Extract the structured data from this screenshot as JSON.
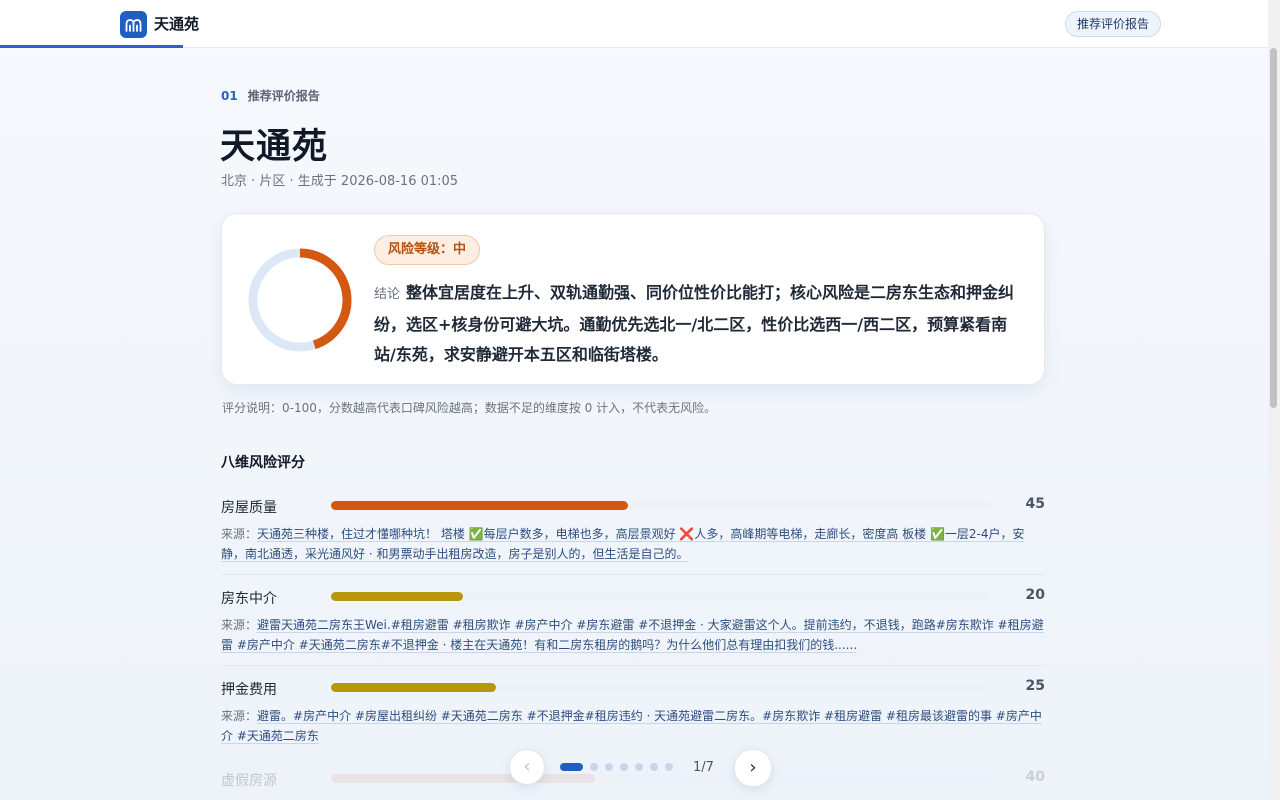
{
  "header": {
    "brand": "天通苑",
    "button_label": "推荐评价报告"
  },
  "hero": {
    "section_number": "01",
    "section_label": "推荐评价报告",
    "title": "天通苑",
    "meta": "北京 · 片区 · 生成于 2026-08-16 01:05"
  },
  "summary": {
    "risk_badge": "风险等级：中",
    "conclusion_label": "结论",
    "conclusion_text": "整体宜居度在上升、双轨通勤强、同价位性价比能打；核心风险是二房东生态和押金纠纷，选区+核身份可避大坑。通勤优先选北一/北二区，性价比选西一/西二区，预算紧看南站/东苑，求安静避开本五区和临街塔楼。",
    "ring_fraction": 0.45,
    "ring_color": "#d4580f"
  },
  "note": "评分说明：0-100，分数越高代表口碑风险越高；数据不足的维度按 0 计入，不代表无风险。",
  "dimensions_title": "八维风险评分",
  "source_label": "来源：",
  "dimensions": [
    {
      "name": "房屋质量",
      "score": "45",
      "value": 45,
      "color": "#d4580f",
      "source": "天通苑三种楼，住过才懂哪种坑！ 塔楼 ✅每层户数多，电梯也多，高层景观好 ❌人多，高峰期等电梯，走廊长，密度高 板楼 ✅一层2-4户，安静，南北通透，采光通风好 · 和男票动手出租房改造，房子是别人的，但生活是自己的。"
    },
    {
      "name": "房东中介",
      "score": "20",
      "value": 20,
      "color": "#b8960e",
      "source": "避雷天通苑二房东王Wei.#租房避雷 #租房欺诈 #房产中介 #房东避雷 #不退押金 · 大家避雷这个人。提前违约，不退钱，跑路#房东欺诈 #租房避雷 #房产中介 #天通苑二房东#不退押金 · 楼主在天通苑！有和二房东租房的鹅吗？为什么他们总有理由扣我们的钱......"
    },
    {
      "name": "押金费用",
      "score": "25",
      "value": 25,
      "color": "#b8960e",
      "source": "避雷。#房产中介 #房屋出租纠纷 #天通苑二房东 #不退押金#租房违约 · 天通苑避雷二房东。#房东欺诈 #租房避雷 #租房最该避雷的事 #房产中介 #天通苑二房东"
    },
    {
      "name": "虚假房源",
      "score": "40",
      "value": 40,
      "color": "#e0a8a0"
    }
  ],
  "pager": {
    "prev": "‹",
    "next": "›",
    "indicator": "1/7",
    "total_pages": 7,
    "current_page": 1
  }
}
